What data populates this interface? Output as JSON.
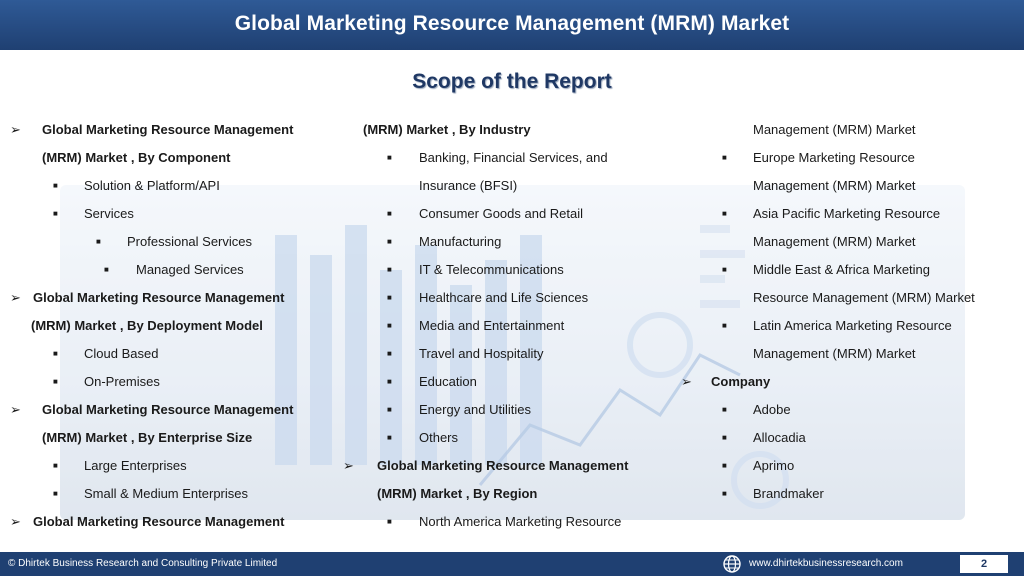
{
  "header": {
    "title": "Global Marketing Resource Management (MRM) Market"
  },
  "subtitle": "Scope of the Report",
  "col1": {
    "l1": "Global Marketing Resource Management",
    "l2": "(MRM) Market , By Component",
    "l3": "Solution & Platform/API",
    "l4": "Services",
    "l5": "Professional Services",
    "l6": "Managed Services",
    "l7": "Global Marketing Resource Management",
    "l8": "(MRM) Market , By Deployment Model",
    "l9": "Cloud Based",
    "l10": "On-Premises",
    "l11": "Global Marketing Resource Management",
    "l12": "(MRM) Market , By Enterprise Size",
    "l13": "Large Enterprises",
    "l14": "Small & Medium Enterprises",
    "l15": "Global Marketing Resource Management"
  },
  "col2": {
    "l1": "(MRM) Market , By Industry",
    "l2": "Banking, Financial Services, and",
    "l3": "Insurance (BFSI)",
    "l4": "Consumer Goods and Retail",
    "l5": "Manufacturing",
    "l6": "IT & Telecommunications",
    "l7": "Healthcare and Life Sciences",
    "l8": "Media and Entertainment",
    "l9": "Travel and Hospitality",
    "l10": "Education",
    "l11": "Energy and Utilities",
    "l12": "Others",
    "l13": "Global Marketing Resource Management",
    "l14": "(MRM) Market , By Region",
    "l15": "North America Marketing Resource"
  },
  "col3": {
    "l1": "Management (MRM) Market",
    "l2": "Europe Marketing Resource",
    "l3": "Management (MRM) Market",
    "l4": "Asia Pacific Marketing Resource",
    "l5": "Management (MRM) Market",
    "l6": "Middle East & Africa Marketing",
    "l7": "Resource Management (MRM) Market",
    "l8": "Latin America Marketing Resource",
    "l9": "Management (MRM) Market",
    "l10": "Company",
    "l11": "Adobe",
    "l12": "Allocadia",
    "l13": "Aprimo",
    "l14": "Brandmaker"
  },
  "footer": {
    "copyright": "© Dhirtek Business Research and Consulting Private Limited",
    "website": "www.dhirtekbusinessresearch.com",
    "page_number": "2"
  },
  "icons": {
    "arrow": "arrow-bullet-icon",
    "square": "square-bullet-icon",
    "globe": "globe-icon"
  },
  "colors": {
    "header_bg": "#1f4072",
    "subtitle": "#1f3864"
  }
}
